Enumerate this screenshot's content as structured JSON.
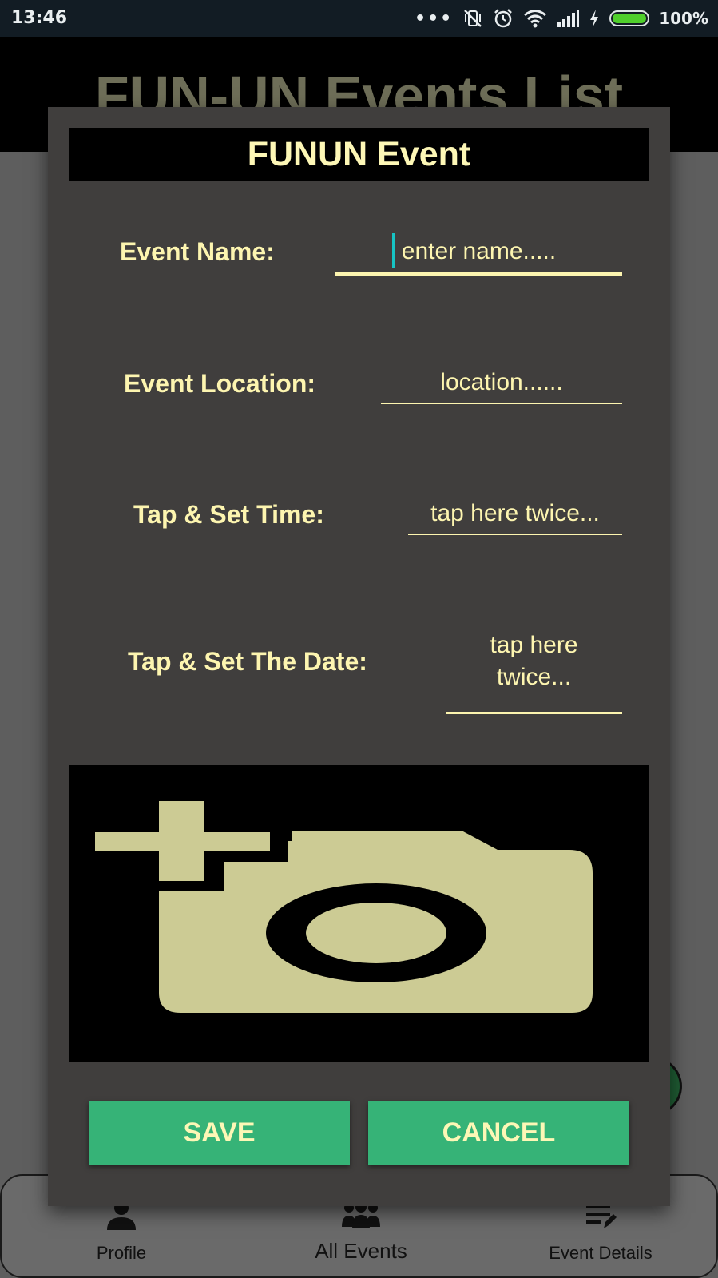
{
  "status_bar": {
    "time": "13:46",
    "battery": "100%",
    "icons": [
      "more-dots-icon",
      "vibrate-off-icon",
      "alarm-icon",
      "wifi-icon",
      "signal-icon",
      "charging-icon",
      "battery-icon"
    ]
  },
  "app": {
    "title": "FUN-UN Events List"
  },
  "dialog": {
    "title": "FUNUN Event",
    "fields": {
      "name": {
        "label": "Event Name:",
        "placeholder": "enter name....."
      },
      "location": {
        "label": "Event Location:",
        "placeholder": "location......"
      },
      "time": {
        "label": "Tap & Set Time:",
        "placeholder": "tap here twice..."
      },
      "date": {
        "label": "Tap & Set The Date:",
        "placeholder": "tap here twice..."
      }
    },
    "image_icon": "add-photo-camera-icon",
    "save_label": "SAVE",
    "cancel_label": "CANCEL"
  },
  "bottom_nav": {
    "items": [
      {
        "label": "Profile",
        "icon": "person-icon"
      },
      {
        "label": "All Events",
        "icon": "group-icon"
      },
      {
        "label": "Event Details",
        "icon": "edit-list-icon"
      }
    ]
  },
  "colors": {
    "accent_text": "#fdf5b0",
    "button": "#36b377",
    "dialog_bg": "#403e3d",
    "camera_fill": "#cccb94",
    "cursor": "#17c4c4"
  }
}
